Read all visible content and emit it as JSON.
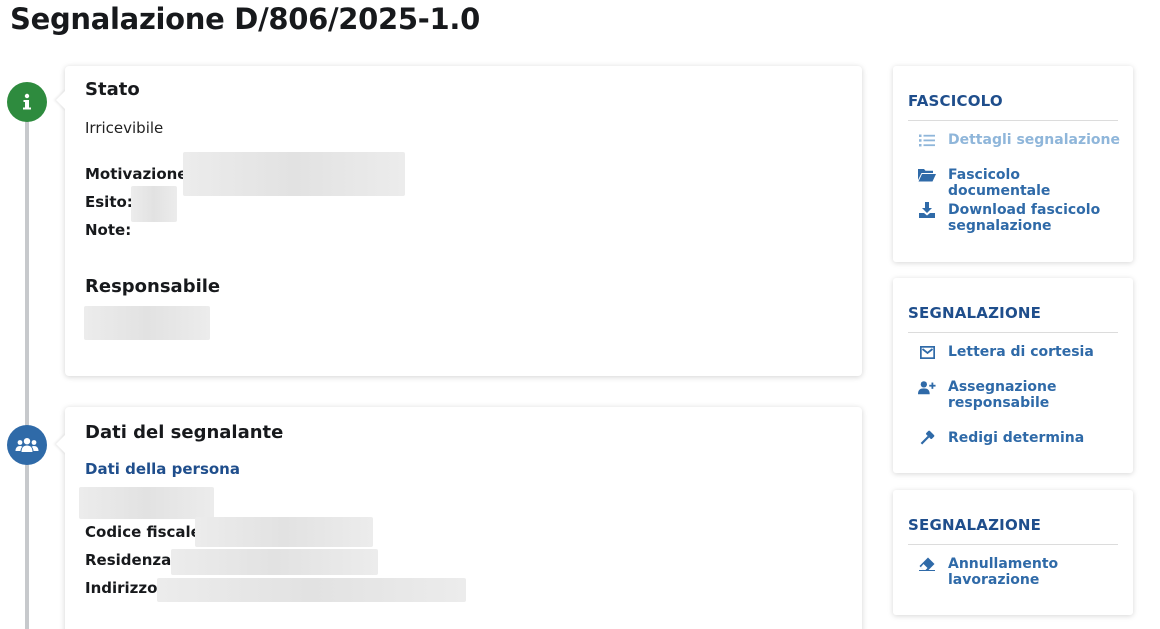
{
  "page": {
    "title": "Segnalazione D/806/2025-1.0"
  },
  "stato_card": {
    "heading": "Stato",
    "status_value": "Irricevibile",
    "motivazione_label": "Motivazione:",
    "esito_label": "Esito:",
    "note_label": "Note:",
    "responsabile_heading": "Responsabile"
  },
  "segnalante_card": {
    "heading": "Dati del segnalante",
    "persona_link": "Dati della persona",
    "codice_fiscale_label": "Codice fiscale:",
    "residenza_label": "Residenza:",
    "indirizzo_label": "Indirizzo:"
  },
  "sidebar": {
    "fascicolo": {
      "title": "FASCICOLO",
      "items": [
        {
          "label": "Dettagli segnalazione",
          "icon": "list-icon",
          "disabled": true
        },
        {
          "label": "Fascicolo documentale",
          "icon": "folder-open-icon"
        },
        {
          "label": "Download fascicolo segnalazione",
          "icon": "download-icon"
        }
      ]
    },
    "segnalazione1": {
      "title": "SEGNALAZIONE",
      "items": [
        {
          "label": "Lettera di cortesia",
          "icon": "envelope-icon"
        },
        {
          "label": "Assegnazione responsabile",
          "icon": "user-plus-icon"
        },
        {
          "label": "Redigi determina",
          "icon": "gavel-icon"
        }
      ]
    },
    "segnalazione2": {
      "title": "SEGNALAZIONE",
      "items": [
        {
          "label": "Annullamento lavorazione",
          "icon": "eraser-icon"
        }
      ]
    }
  },
  "colors": {
    "accent": "#2f6aa8",
    "dark_blue": "#1f4e8c",
    "success": "#2e8b3e"
  }
}
